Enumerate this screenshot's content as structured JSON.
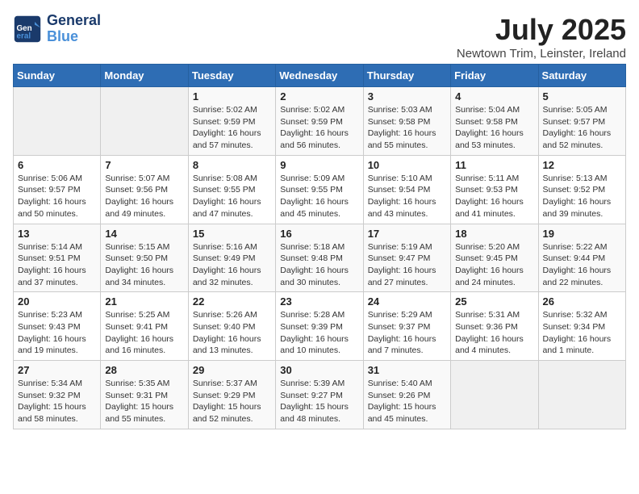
{
  "header": {
    "logo_line1": "General",
    "logo_line2": "Blue",
    "month": "July 2025",
    "location": "Newtown Trim, Leinster, Ireland"
  },
  "weekdays": [
    "Sunday",
    "Monday",
    "Tuesday",
    "Wednesday",
    "Thursday",
    "Friday",
    "Saturday"
  ],
  "weeks": [
    [
      {
        "day": "",
        "text": ""
      },
      {
        "day": "",
        "text": ""
      },
      {
        "day": "1",
        "text": "Sunrise: 5:02 AM\nSunset: 9:59 PM\nDaylight: 16 hours and 57 minutes."
      },
      {
        "day": "2",
        "text": "Sunrise: 5:02 AM\nSunset: 9:59 PM\nDaylight: 16 hours and 56 minutes."
      },
      {
        "day": "3",
        "text": "Sunrise: 5:03 AM\nSunset: 9:58 PM\nDaylight: 16 hours and 55 minutes."
      },
      {
        "day": "4",
        "text": "Sunrise: 5:04 AM\nSunset: 9:58 PM\nDaylight: 16 hours and 53 minutes."
      },
      {
        "day": "5",
        "text": "Sunrise: 5:05 AM\nSunset: 9:57 PM\nDaylight: 16 hours and 52 minutes."
      }
    ],
    [
      {
        "day": "6",
        "text": "Sunrise: 5:06 AM\nSunset: 9:57 PM\nDaylight: 16 hours and 50 minutes."
      },
      {
        "day": "7",
        "text": "Sunrise: 5:07 AM\nSunset: 9:56 PM\nDaylight: 16 hours and 49 minutes."
      },
      {
        "day": "8",
        "text": "Sunrise: 5:08 AM\nSunset: 9:55 PM\nDaylight: 16 hours and 47 minutes."
      },
      {
        "day": "9",
        "text": "Sunrise: 5:09 AM\nSunset: 9:55 PM\nDaylight: 16 hours and 45 minutes."
      },
      {
        "day": "10",
        "text": "Sunrise: 5:10 AM\nSunset: 9:54 PM\nDaylight: 16 hours and 43 minutes."
      },
      {
        "day": "11",
        "text": "Sunrise: 5:11 AM\nSunset: 9:53 PM\nDaylight: 16 hours and 41 minutes."
      },
      {
        "day": "12",
        "text": "Sunrise: 5:13 AM\nSunset: 9:52 PM\nDaylight: 16 hours and 39 minutes."
      }
    ],
    [
      {
        "day": "13",
        "text": "Sunrise: 5:14 AM\nSunset: 9:51 PM\nDaylight: 16 hours and 37 minutes."
      },
      {
        "day": "14",
        "text": "Sunrise: 5:15 AM\nSunset: 9:50 PM\nDaylight: 16 hours and 34 minutes."
      },
      {
        "day": "15",
        "text": "Sunrise: 5:16 AM\nSunset: 9:49 PM\nDaylight: 16 hours and 32 minutes."
      },
      {
        "day": "16",
        "text": "Sunrise: 5:18 AM\nSunset: 9:48 PM\nDaylight: 16 hours and 30 minutes."
      },
      {
        "day": "17",
        "text": "Sunrise: 5:19 AM\nSunset: 9:47 PM\nDaylight: 16 hours and 27 minutes."
      },
      {
        "day": "18",
        "text": "Sunrise: 5:20 AM\nSunset: 9:45 PM\nDaylight: 16 hours and 24 minutes."
      },
      {
        "day": "19",
        "text": "Sunrise: 5:22 AM\nSunset: 9:44 PM\nDaylight: 16 hours and 22 minutes."
      }
    ],
    [
      {
        "day": "20",
        "text": "Sunrise: 5:23 AM\nSunset: 9:43 PM\nDaylight: 16 hours and 19 minutes."
      },
      {
        "day": "21",
        "text": "Sunrise: 5:25 AM\nSunset: 9:41 PM\nDaylight: 16 hours and 16 minutes."
      },
      {
        "day": "22",
        "text": "Sunrise: 5:26 AM\nSunset: 9:40 PM\nDaylight: 16 hours and 13 minutes."
      },
      {
        "day": "23",
        "text": "Sunrise: 5:28 AM\nSunset: 9:39 PM\nDaylight: 16 hours and 10 minutes."
      },
      {
        "day": "24",
        "text": "Sunrise: 5:29 AM\nSunset: 9:37 PM\nDaylight: 16 hours and 7 minutes."
      },
      {
        "day": "25",
        "text": "Sunrise: 5:31 AM\nSunset: 9:36 PM\nDaylight: 16 hours and 4 minutes."
      },
      {
        "day": "26",
        "text": "Sunrise: 5:32 AM\nSunset: 9:34 PM\nDaylight: 16 hours and 1 minute."
      }
    ],
    [
      {
        "day": "27",
        "text": "Sunrise: 5:34 AM\nSunset: 9:32 PM\nDaylight: 15 hours and 58 minutes."
      },
      {
        "day": "28",
        "text": "Sunrise: 5:35 AM\nSunset: 9:31 PM\nDaylight: 15 hours and 55 minutes."
      },
      {
        "day": "29",
        "text": "Sunrise: 5:37 AM\nSunset: 9:29 PM\nDaylight: 15 hours and 52 minutes."
      },
      {
        "day": "30",
        "text": "Sunrise: 5:39 AM\nSunset: 9:27 PM\nDaylight: 15 hours and 48 minutes."
      },
      {
        "day": "31",
        "text": "Sunrise: 5:40 AM\nSunset: 9:26 PM\nDaylight: 15 hours and 45 minutes."
      },
      {
        "day": "",
        "text": ""
      },
      {
        "day": "",
        "text": ""
      }
    ]
  ]
}
